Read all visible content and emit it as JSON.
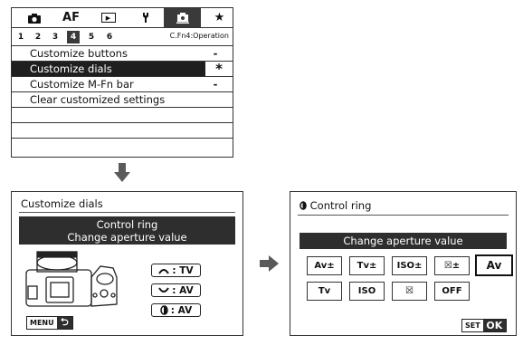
{
  "menu": {
    "tabs": [
      {
        "icon": "camera-icon",
        "glyph": "",
        "active": false
      },
      {
        "icon": "af-icon",
        "glyph": "AF",
        "active": false
      },
      {
        "icon": "playback-icon",
        "glyph": "▶",
        "active": false
      },
      {
        "icon": "wrench-icon",
        "glyph": "",
        "active": false
      },
      {
        "icon": "custom-function-icon",
        "glyph": "",
        "active": true
      },
      {
        "icon": "star-icon",
        "glyph": "★",
        "active": false
      }
    ],
    "pages": [
      "1",
      "2",
      "3",
      "4",
      "5",
      "6"
    ],
    "active_page": "4",
    "page_caption": "C.Fn4:Operation",
    "rows": [
      {
        "label": "Customize buttons",
        "value": "-"
      },
      {
        "label": "Customize dials",
        "value": "*"
      },
      {
        "label": "Customize M-Fn bar",
        "value": "-"
      },
      {
        "label": "Clear customized settings",
        "value": ""
      },
      {
        "label": "",
        "value": ""
      },
      {
        "label": "",
        "value": ""
      },
      {
        "label": "",
        "value": ""
      }
    ]
  },
  "left_screen": {
    "title": "Customize dials",
    "info_line1": "Control ring",
    "info_line2": "Change aperture value",
    "dials": [
      {
        "icon": "main-dial-icon",
        "label": ": TV"
      },
      {
        "icon": "quick-dial-icon",
        "label": ": AV"
      },
      {
        "icon": "control-ring-icon",
        "label": ": AV"
      }
    ],
    "menu_button": "MENU",
    "return_glyph": "⮌"
  },
  "right_screen": {
    "title": "Control ring",
    "selected_label": "Change aperture value",
    "options": [
      "Av±",
      "Tv±",
      "ISO±",
      "☒±",
      "Av",
      "Tv",
      "ISO",
      "☒",
      "OFF"
    ],
    "set_button": "SET",
    "ok_label": "OK"
  },
  "colors": {
    "dark": "#2e2e2e",
    "border": "#333333",
    "arrow": "#5a5a5a"
  }
}
